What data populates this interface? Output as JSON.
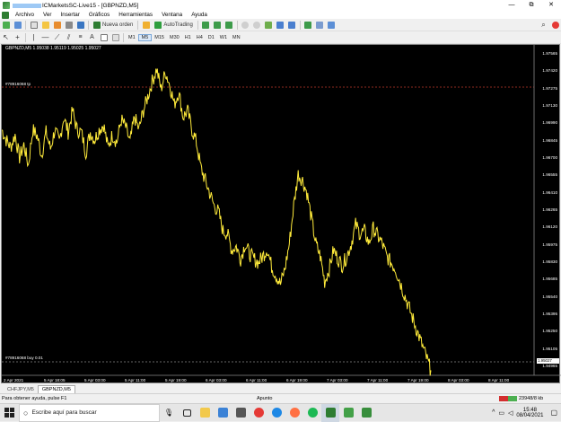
{
  "window": {
    "account_id_masked": "",
    "title_suffix": "ICMarketsSC-Live15 - [GBPNZD,M5]"
  },
  "window_controls": [
    "—",
    "⧉",
    "✕"
  ],
  "menu": [
    "Archivo",
    "Ver",
    "Insertar",
    "Gráficos",
    "Herramientas",
    "Ventana",
    "Ayuda"
  ],
  "toolbar": {
    "new_order": "Nueva orden",
    "autotrading": "AutoTrading"
  },
  "timeframes": [
    "M1",
    "M5",
    "M15",
    "M30",
    "H1",
    "H4",
    "D1",
    "W1",
    "MN"
  ],
  "active_timeframe": "M5",
  "chart": {
    "header": "GBPNZD,M5  1.95038 1.95119 1.95025 1.95027",
    "tp_label": "#78916068 tp",
    "buy_label": "#78916068 buy 0.01",
    "current_price": "1.95027",
    "y_ticks": [
      "1.97565",
      "1.97420",
      "1.97275",
      "1.97130",
      "1.96990",
      "1.96845",
      "1.96700",
      "1.96555",
      "1.96410",
      "1.96265",
      "1.96120",
      "1.95975",
      "1.95830",
      "1.95685",
      "1.95540",
      "1.95395",
      "1.95250",
      "1.95105",
      "1.94965"
    ],
    "x_ticks": [
      "2 Apr 2021",
      "5 Apr 18:05",
      "5 Apr 03:00",
      "5 Apr 11:00",
      "5 Apr 19:00",
      "6 Apr 03:00",
      "6 Apr 11:00",
      "6 Apr 19:00",
      "7 Apr 03:00",
      "7 Apr 11:00",
      "7 Apr 19:00",
      "8 Apr 03:00",
      "8 Apr 11:00"
    ]
  },
  "chart_data": {
    "type": "line",
    "series": [
      {
        "values": [
          1.969,
          1.9682,
          1.9676,
          1.9686,
          1.9668,
          1.9678,
          1.9662,
          1.969,
          1.9685,
          1.967,
          1.9688,
          1.9675,
          1.969,
          1.968,
          1.97,
          1.9688,
          1.9705,
          1.969,
          1.9688,
          1.9672,
          1.9688,
          1.9682,
          1.969,
          1.9694,
          1.9676,
          1.9686,
          1.968,
          1.9698,
          1.9692,
          1.968,
          1.97,
          1.969,
          1.9705,
          1.9716,
          1.9728,
          1.9738,
          1.9722,
          1.9736,
          1.9725,
          1.971,
          1.972,
          1.97,
          1.9705,
          1.969,
          1.968,
          1.966,
          1.965,
          1.964,
          1.963,
          1.9625,
          1.961,
          1.9608,
          1.9595,
          1.9598,
          1.9588,
          1.96,
          1.9592,
          1.9588,
          1.9585,
          1.959,
          1.9596,
          1.9582,
          1.9575,
          1.9568,
          1.958,
          1.96,
          1.963,
          1.9655,
          1.965,
          1.964,
          1.962,
          1.96,
          1.959,
          1.957,
          1.958,
          1.9595,
          1.9588,
          1.9583,
          1.959,
          1.96,
          1.9615,
          1.9608,
          1.961,
          1.96,
          1.9612,
          1.9606,
          1.96,
          1.959,
          1.9585,
          1.958,
          1.957,
          1.956,
          1.955,
          1.954,
          1.953,
          1.952,
          1.951,
          1.95
        ]
      }
    ],
    "ylim": [
      1.9496,
      1.9757
    ]
  },
  "tabs": [
    "CHFJPY,M5",
    "GBPNZD,M5"
  ],
  "active_tab": "GBPNZD,M5",
  "status": {
    "help": "Para obtener ayuda, pulse F1",
    "mode": "Apunto",
    "traffic": "23948/8 kb"
  },
  "taskbar": {
    "search_placeholder": "Escribe aquí para buscar",
    "time": "15:48",
    "date": "08/04/2021"
  }
}
